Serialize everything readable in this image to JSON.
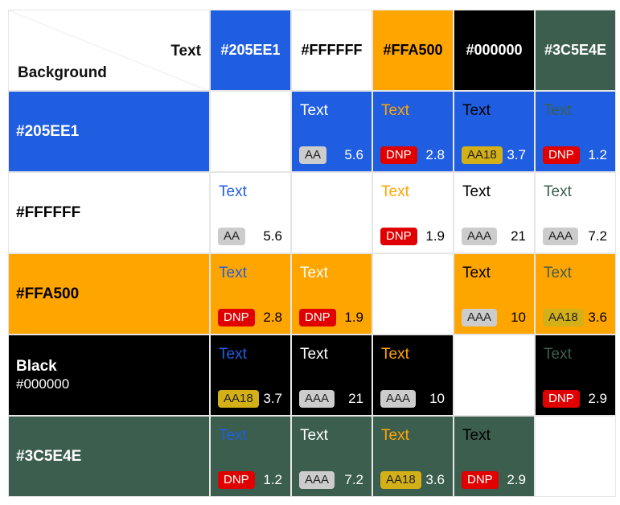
{
  "header": {
    "text_label": "Text",
    "background_label": "Background"
  },
  "colors": [
    {
      "hex": "#205EE1",
      "header_label": "#205EE1",
      "row_label": "#205EE1",
      "row_sub": "",
      "header_text_color": "#ffffff",
      "row_text_color": "#ffffff"
    },
    {
      "hex": "#FFFFFF",
      "header_label": "#FFFFFF",
      "row_label": "#FFFFFF",
      "row_sub": "",
      "header_text_color": "#000000",
      "row_text_color": "#000000"
    },
    {
      "hex": "#FFA500",
      "header_label": "#FFA500",
      "row_label": "#FFA500",
      "row_sub": "",
      "header_text_color": "#000000",
      "row_text_color": "#000000"
    },
    {
      "hex": "#000000",
      "header_label": "#000000",
      "row_label": "Black",
      "row_sub": "#000000",
      "header_text_color": "#ffffff",
      "row_text_color": "#ffffff"
    },
    {
      "hex": "#3C5E4E",
      "header_label": "#3C5E4E",
      "row_label": "#3C5E4E",
      "row_sub": "",
      "header_text_color": "#ffffff",
      "row_text_color": "#ffffff"
    }
  ],
  "badge_styles": {
    "AA": {
      "bg": "#cccccc",
      "fg": "#222222"
    },
    "AAA": {
      "bg": "#cccccc",
      "fg": "#222222"
    },
    "AA18": {
      "bg": "#d4b018",
      "fg": "#222222"
    },
    "DNP": {
      "bg": "#e00000",
      "fg": "#ffffff"
    }
  },
  "matrix": [
    [
      null,
      {
        "sample": "Text",
        "rating": "AA",
        "ratio": "5.6"
      },
      {
        "sample": "Text",
        "rating": "DNP",
        "ratio": "2.8"
      },
      {
        "sample": "Text",
        "rating": "AA18",
        "ratio": "3.7"
      },
      {
        "sample": "Text",
        "rating": "DNP",
        "ratio": "1.2"
      }
    ],
    [
      {
        "sample": "Text",
        "rating": "AA",
        "ratio": "5.6"
      },
      null,
      {
        "sample": "Text",
        "rating": "DNP",
        "ratio": "1.9"
      },
      {
        "sample": "Text",
        "rating": "AAA",
        "ratio": "21"
      },
      {
        "sample": "Text",
        "rating": "AAA",
        "ratio": "7.2"
      }
    ],
    [
      {
        "sample": "Text",
        "rating": "DNP",
        "ratio": "2.8"
      },
      {
        "sample": "Text",
        "rating": "DNP",
        "ratio": "1.9"
      },
      null,
      {
        "sample": "Text",
        "rating": "AAA",
        "ratio": "10"
      },
      {
        "sample": "Text",
        "rating": "AA18",
        "ratio": "3.6"
      }
    ],
    [
      {
        "sample": "Text",
        "rating": "AA18",
        "ratio": "3.7"
      },
      {
        "sample": "Text",
        "rating": "AAA",
        "ratio": "21"
      },
      {
        "sample": "Text",
        "rating": "AAA",
        "ratio": "10"
      },
      null,
      {
        "sample": "Text",
        "rating": "DNP",
        "ratio": "2.9"
      }
    ],
    [
      {
        "sample": "Text",
        "rating": "DNP",
        "ratio": "1.2"
      },
      {
        "sample": "Text",
        "rating": "AAA",
        "ratio": "7.2"
      },
      {
        "sample": "Text",
        "rating": "AA18",
        "ratio": "3.6"
      },
      {
        "sample": "Text",
        "rating": "DNP",
        "ratio": "2.9"
      },
      null
    ]
  ]
}
